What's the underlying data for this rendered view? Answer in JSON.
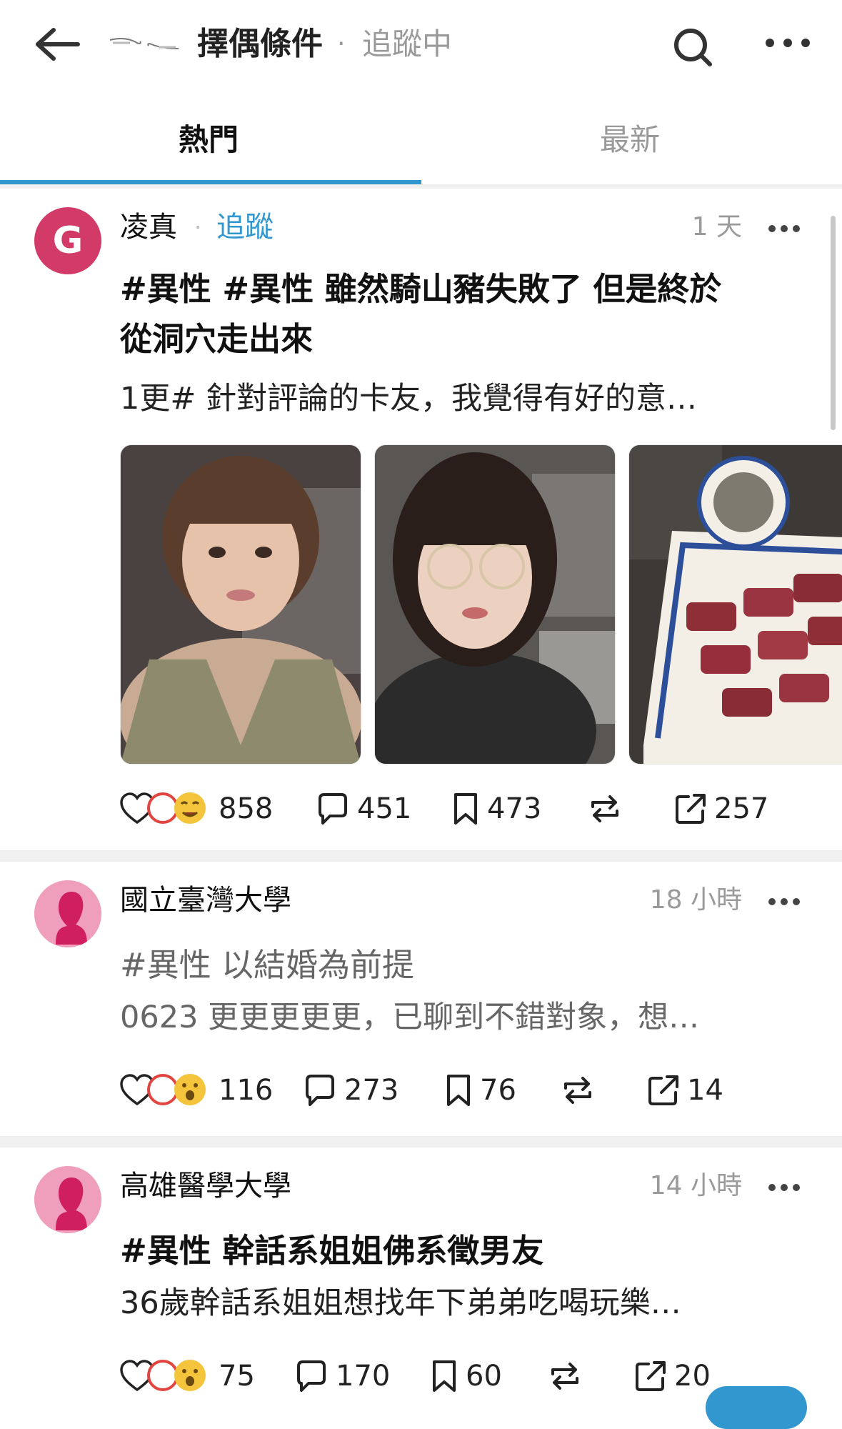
{
  "header": {
    "board_title": "擇偶條件",
    "separator": "·",
    "follow_status": "追蹤中"
  },
  "tabs": [
    {
      "label": "熱門",
      "active": true
    },
    {
      "label": "最新",
      "active": false
    }
  ],
  "accent_color": "#3397cf",
  "posts": [
    {
      "author": "凌真",
      "follow_sep": "·",
      "follow_label": "追蹤",
      "time": "1 天",
      "title_line1": "#異性 #異性 雖然騎山豬失敗了 但是終於",
      "title_line2": "從洞穴走出來",
      "excerpt": "1更# 針對評論的卡友，我覺得有好的意…",
      "avatar_letter": "G",
      "avatar_color": "#d23a67",
      "photos": [
        "selfie-green-top",
        "selfie-glasses",
        "steak-plate"
      ],
      "reactions": "858",
      "comments": "451",
      "saves": "473",
      "shares": "257"
    },
    {
      "author": "國立臺灣大學",
      "time": "18 小時",
      "title": "#異性 以結婚為前提",
      "excerpt": "0623 更更更更更，已聊到不錯對象，想…",
      "reactions": "116",
      "comments": "273",
      "saves": "76",
      "shares": "14"
    },
    {
      "author": "高雄醫學大學",
      "time": "14 小時",
      "title": "#異性 幹話系姐姐佛系徵男友",
      "excerpt": "36歲幹話系姐姐想找年下弟弟吃喝玩樂…",
      "reactions": "75",
      "comments": "170",
      "saves": "60",
      "shares": "20"
    }
  ]
}
